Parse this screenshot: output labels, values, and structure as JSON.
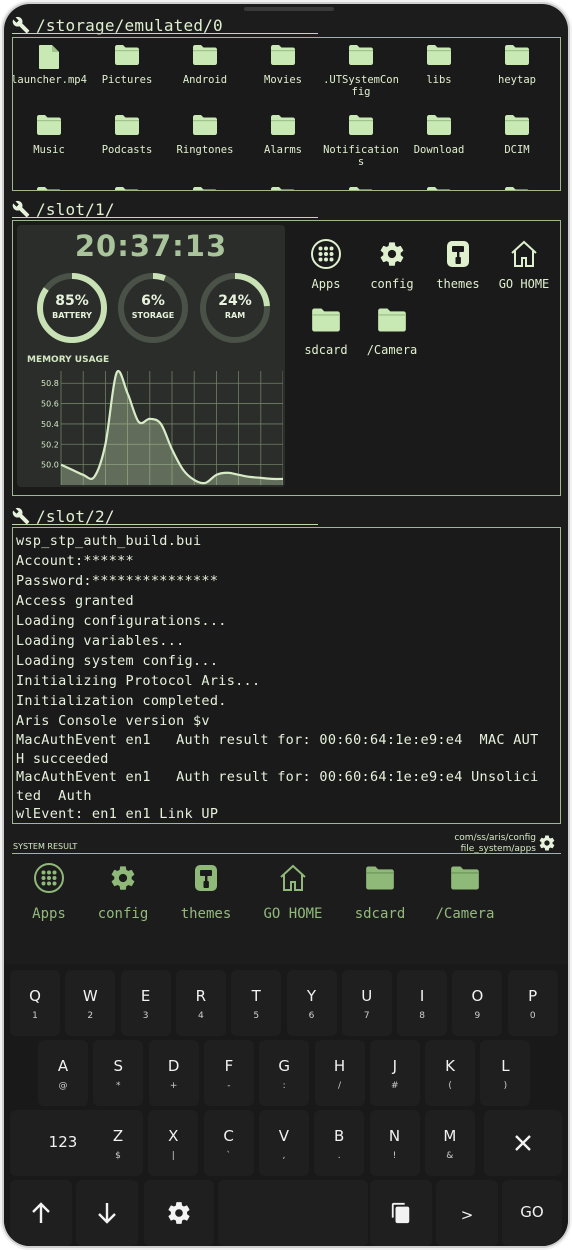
{
  "slot0": {
    "path": "/storage/emulated/0",
    "files": [
      {
        "name": "launcher.mp4",
        "icon": "file-icon"
      },
      {
        "name": "Pictures",
        "icon": "folder-icon"
      },
      {
        "name": "Android",
        "icon": "folder-icon"
      },
      {
        "name": "Movies",
        "icon": "folder-icon"
      },
      {
        "name": ".UTSystemConfig",
        "icon": "folder-icon"
      },
      {
        "name": "libs",
        "icon": "folder-icon"
      },
      {
        "name": "heytap",
        "icon": "folder-icon"
      },
      {
        "name": "Music",
        "icon": "folder-icon"
      },
      {
        "name": "Podcasts",
        "icon": "folder-icon"
      },
      {
        "name": "Ringtones",
        "icon": "folder-icon"
      },
      {
        "name": "Alarms",
        "icon": "folder-icon"
      },
      {
        "name": "Notifications",
        "icon": "folder-icon"
      },
      {
        "name": "Download",
        "icon": "folder-icon"
      },
      {
        "name": "DCIM",
        "icon": "folder-icon"
      }
    ]
  },
  "slot1": {
    "path": "/slot/1/",
    "widget": {
      "clock": "20:37:13",
      "rings": [
        {
          "value": "85%",
          "label": "BATTERY",
          "fraction": 0.85
        },
        {
          "value": "6%",
          "label": "STORAGE",
          "fraction": 0.06
        },
        {
          "value": "24%",
          "label": "RAM",
          "fraction": 0.24
        }
      ],
      "memory_title": "MEMORY USAGE"
    },
    "apps": [
      {
        "label": "Apps",
        "icon": "apps-grid-icon"
      },
      {
        "label": "config",
        "icon": "gear-icon"
      },
      {
        "label": "themes",
        "icon": "paint-roller-icon"
      },
      {
        "label": "GO HOME",
        "icon": "home-icon"
      },
      {
        "label": "sdcard",
        "icon": "folder-icon"
      },
      {
        "label": "/Camera",
        "icon": "folder-icon"
      }
    ]
  },
  "chart_data": {
    "type": "area",
    "title": "MEMORY USAGE",
    "xlabel": "",
    "ylabel": "",
    "yticks": [
      "50.8",
      "50.6",
      "50.4",
      "50.2",
      "50.0"
    ],
    "ylim": [
      49.8,
      50.92
    ],
    "x": [
      0,
      1,
      2,
      3,
      4,
      5,
      6,
      7,
      8,
      9,
      10,
      11,
      12,
      13,
      14,
      15,
      16,
      17,
      18,
      19,
      20
    ],
    "values": [
      50.0,
      49.95,
      49.9,
      49.88,
      50.2,
      50.9,
      50.7,
      50.42,
      50.45,
      50.4,
      50.15,
      49.95,
      49.85,
      49.82,
      49.9,
      49.92,
      49.9,
      49.88,
      49.87,
      49.86,
      49.86
    ],
    "grid": true
  },
  "slot2": {
    "path": "/slot/2/",
    "lines": [
      "wsp_stp_auth_build.bui",
      "Account:******",
      "Password:***************",
      "Access granted",
      "Loading configurations...",
      "Loading variables...",
      "Loading system config...",
      "Initializing Protocol Aris...",
      "Initialization completed.",
      "Aris Console version $v",
      "MacAuthEvent en1   Auth result for: 00:60:64:1e:e9:e4  MAC AUT",
      "H succeeded",
      "MacAuthEvent en1   Auth result for: 00:60:64:1e:e9:e4 Unsolici",
      "ted  Auth",
      "wlEvent: en1 en1 Link UP"
    ]
  },
  "system": {
    "label": "SYSTEM RESULT",
    "path_line1": "com/ss/aris/config",
    "path_line2": "file_system/apps",
    "dock": [
      {
        "label": "Apps",
        "icon": "apps-grid-icon"
      },
      {
        "label": "config",
        "icon": "gear-icon"
      },
      {
        "label": "themes",
        "icon": "paint-roller-icon"
      },
      {
        "label": "GO HOME",
        "icon": "home-icon"
      },
      {
        "label": "sdcard",
        "icon": "folder-icon"
      },
      {
        "label": "/Camera",
        "icon": "folder-icon"
      }
    ]
  },
  "keyboard": {
    "row1": [
      {
        "main": "Q",
        "sub": "1"
      },
      {
        "main": "W",
        "sub": "2"
      },
      {
        "main": "E",
        "sub": "3"
      },
      {
        "main": "R",
        "sub": "4"
      },
      {
        "main": "T",
        "sub": "5"
      },
      {
        "main": "Y",
        "sub": "6"
      },
      {
        "main": "U",
        "sub": "7"
      },
      {
        "main": "I",
        "sub": "8"
      },
      {
        "main": "O",
        "sub": "9"
      },
      {
        "main": "P",
        "sub": "0"
      }
    ],
    "row2": [
      {
        "main": "A",
        "sub": "@"
      },
      {
        "main": "S",
        "sub": "*"
      },
      {
        "main": "D",
        "sub": "+"
      },
      {
        "main": "F",
        "sub": "-"
      },
      {
        "main": "G",
        "sub": ":"
      },
      {
        "main": "H",
        "sub": "/"
      },
      {
        "main": "J",
        "sub": "#"
      },
      {
        "main": "K",
        "sub": "("
      },
      {
        "main": "L",
        "sub": ")"
      }
    ],
    "row3": [
      {
        "main": "123",
        "sub": ""
      },
      {
        "main": "Z",
        "sub": "$"
      },
      {
        "main": "X",
        "sub": "|"
      },
      {
        "main": "C",
        "sub": "`"
      },
      {
        "main": "V",
        "sub": ","
      },
      {
        "main": "B",
        "sub": "."
      },
      {
        "main": "N",
        "sub": "!"
      },
      {
        "main": "M",
        "sub": "&"
      }
    ],
    "enter_right": ">",
    "go": "GO",
    "icons": {
      "delete": "close-icon",
      "up": "arrow-up-icon",
      "down": "arrow-down-icon",
      "settings": "gear-icon",
      "copy": "copy-icon"
    }
  },
  "colors": {
    "accent": "#d9ecc9",
    "folder": "#c8e8b4",
    "dock_label": "#92bb7b",
    "background": "#1c1c1c"
  }
}
